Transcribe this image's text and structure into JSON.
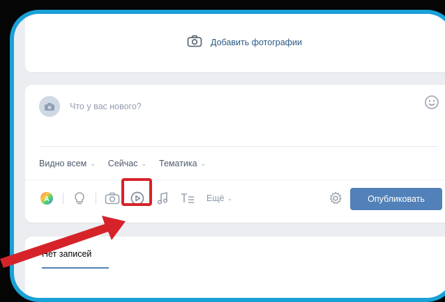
{
  "photos": {
    "add_label": "Добавить фотографии",
    "icon": "camera-icon"
  },
  "composer": {
    "placeholder": "Что у вас нового?",
    "options": [
      {
        "label": "Видно всем"
      },
      {
        "label": "Сейчас"
      },
      {
        "label": "Тематика"
      }
    ],
    "more_label": "Ещё",
    "publish_label": "Опубликовать"
  },
  "posts": {
    "tab_label": "Нет записей"
  },
  "colors": {
    "frame": "#1aa1d6",
    "highlight": "#d6232a",
    "accent": "#5181b8"
  }
}
